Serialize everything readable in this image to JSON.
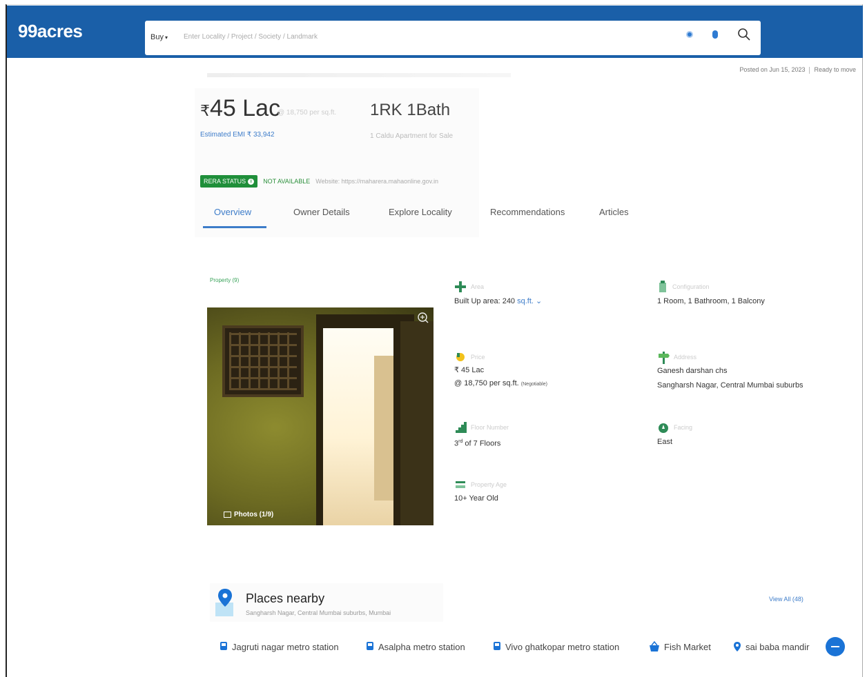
{
  "header": {
    "logo": "99acres",
    "buy_label": "Buy",
    "search_placeholder": "Enter Locality / Project / Society / Landmark"
  },
  "listing": {
    "posted": "Posted on Jun 15, 2023",
    "status": "Ready to move",
    "price_symbol": "₹",
    "price": "45 Lac",
    "price_sub": "@ 18,750 per sq.ft.",
    "emi": "Estimated EMI ₹ 33,942",
    "config": "1RK 1Bath",
    "config_sub": "1 Caldu Apartment for Sale",
    "rera_badge": "RERA STATUS",
    "rera_value": "NOT AVAILABLE",
    "rera_website": "Website: https://maharera.mahaonline.gov.in"
  },
  "tabs": [
    "Overview",
    "Owner Details",
    "Explore Locality",
    "Recommendations",
    "Articles"
  ],
  "property": {
    "section_label": "Property (9)",
    "photos_label": "Photos (1/9)",
    "area_label": "Area",
    "area_value": "Built Up area: 240",
    "area_unit": "sq.ft.",
    "config_label": "Configuration",
    "config_value": "1 Room, 1 Bathroom, 1 Balcony",
    "price_label": "Price",
    "price_value": "₹ 45 Lac",
    "price_per": "@ 18,750 per sq.ft.",
    "negotiable": "(Negotiable)",
    "address_label": "Address",
    "address_1": "Ganesh darshan chs",
    "address_2": "Sangharsh Nagar, Central Mumbai suburbs",
    "floor_label": "Floor Number",
    "floor_num": "3",
    "floor_sup": "rd",
    "floor_of": "of 7 Floors",
    "facing_label": "Facing",
    "facing_value": "East",
    "age_label": "Property Age",
    "age_value": "10+ Year Old"
  },
  "places": {
    "title": "Places nearby",
    "subtitle": "Sangharsh Nagar, Central Mumbai suburbs, Mumbai",
    "view_all": "View All (48)",
    "chips": [
      "Jagruti nagar metro station",
      "Asalpha metro station",
      "Vivo ghatkopar metro station",
      "Fish Market",
      "sai baba mandir"
    ]
  },
  "colors": {
    "brand": "#1a5fa8",
    "accent": "#3d7cc9",
    "rera": "#1f8f3a"
  }
}
